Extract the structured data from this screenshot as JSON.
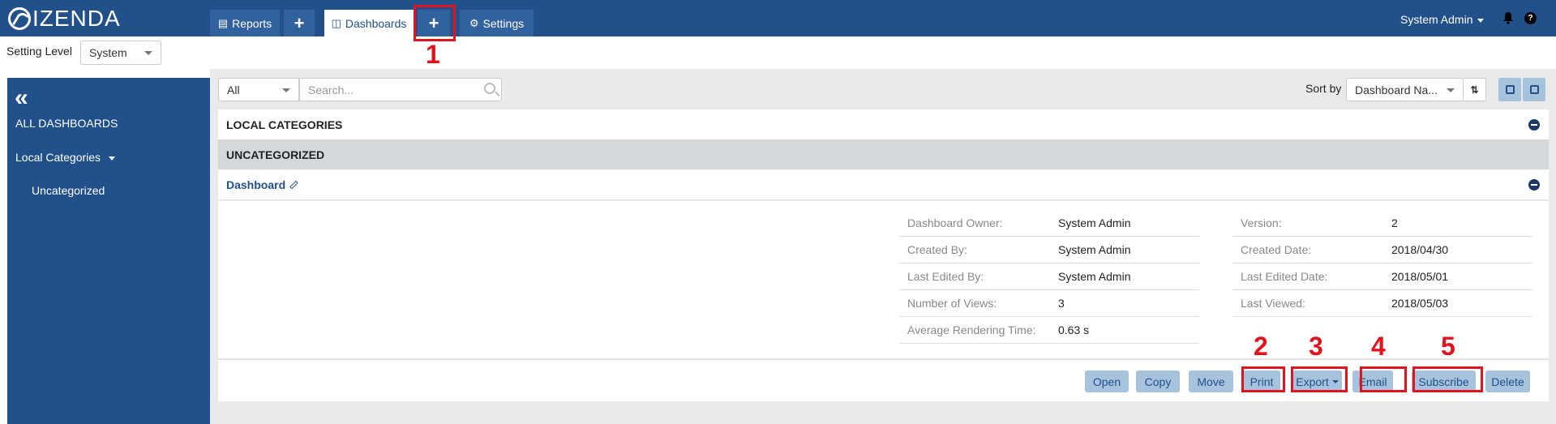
{
  "brand": {
    "name": "IZENDA"
  },
  "nav": {
    "tabs": [
      {
        "label": "Reports"
      },
      {
        "label": "Dashboards"
      },
      {
        "label": "Settings"
      }
    ],
    "plus": "+"
  },
  "user": {
    "name": "System Admin",
    "help": "?"
  },
  "settings": {
    "level_label": "Setting Level",
    "level_value": "System"
  },
  "sidebar": {
    "collapse": "«",
    "items": [
      {
        "label": "ALL DASHBOARDS"
      },
      {
        "label": "Local Categories"
      },
      {
        "label": "Uncategorized"
      }
    ]
  },
  "toolbar": {
    "filter_value": "All",
    "search_placeholder": "Search...",
    "sort_label": "Sort by",
    "sort_value": "Dashboard Na..."
  },
  "list": {
    "local_categories": "LOCAL CATEGORIES",
    "uncategorized": "UNCATEGORIZED",
    "dashboard_name": "Dashboard"
  },
  "details": {
    "left": [
      {
        "key": "Dashboard Owner:",
        "value": "System Admin"
      },
      {
        "key": "Created By:",
        "value": "System Admin"
      },
      {
        "key": "Last Edited By:",
        "value": "System Admin"
      },
      {
        "key": "Number of Views:",
        "value": "3"
      },
      {
        "key": "Average Rendering Time:",
        "value": "0.63 s"
      }
    ],
    "right": [
      {
        "key": "Version:",
        "value": "2"
      },
      {
        "key": "Created Date:",
        "value": "2018/04/30"
      },
      {
        "key": "Last Edited Date:",
        "value": "2018/05/01"
      },
      {
        "key": "Last Viewed:",
        "value": "2018/05/03"
      }
    ]
  },
  "actions": {
    "open": "Open",
    "copy": "Copy",
    "move": "Move",
    "print": "Print",
    "export": "Export",
    "email": "Email",
    "subscribe": "Subscribe",
    "delete": "Delete"
  },
  "annotations": [
    "1",
    "2",
    "3",
    "4",
    "5"
  ],
  "colors": {
    "header": "#21508a",
    "highlight": "#e0141e",
    "button": "#a7c2dd"
  }
}
